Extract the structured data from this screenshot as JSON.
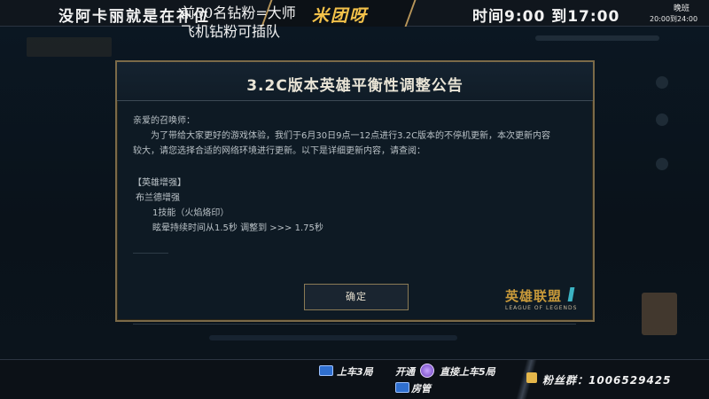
{
  "overlay_top": {
    "left_text": "没阿卡丽就是在补位",
    "center_text": "米团呀",
    "right_text": "时间9:00 到17:00",
    "shift_label": "晚班",
    "shift_times": "20:00到24:00"
  },
  "modal": {
    "title": "3.2C版本英雄平衡性调整公告",
    "greeting": "亲爱的召唤师：",
    "intro_line1": "为了带给大家更好的游戏体验，我们于6月30日9点一12点进行3.2C版本的不停机更新，本次更新内容",
    "intro_line2": "较大，请您选择合适的网络环境进行更新。以下是详细更新内容，请查阅：",
    "section_header": "【英雄增强】",
    "champion": "布兰德增强",
    "ability": "1技能（火焰烙印）",
    "change": "眩晕持续时间从1.5秒 调整到 >>> 1.75秒",
    "confirm_button": "确定",
    "logo_main": "英雄联盟",
    "logo_sub": "LEAGUE OF LEGENDS"
  },
  "overlay_bottom": {
    "line1": "前50名钻粉=大师",
    "line2": "飞机钻粉可插队",
    "badge1_text": "上车3局",
    "badge2_text": "开通",
    "badge2_suffix": "直接上车5局",
    "badge3_text": "房管",
    "fan_group": "粉丝群：1006529425"
  },
  "colors": {
    "accent_gold": "#f4c24a",
    "modal_border": "#7b6a48",
    "logo_blue": "#3bb3c3"
  }
}
